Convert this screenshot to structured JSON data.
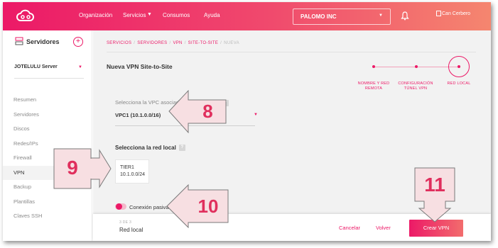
{
  "topbar": {
    "nav": [
      "Organización",
      "Servicios",
      "Consumos",
      "Ayuda"
    ],
    "company": "PALOMO INC",
    "user": "Can Cerbero",
    "logo_icon": "cloud-logo",
    "bell_icon": "bell-icon"
  },
  "sidebar": {
    "title": "Servidores",
    "add_icon": "plus-circle-icon",
    "server": "JOTELULU Server",
    "menu": [
      "Resumen",
      "Servidores",
      "Discos",
      "Redes/IPs",
      "Firewall",
      "VPN",
      "Backup",
      "Plantillas",
      "Claves SSH"
    ],
    "active_item": "VPN"
  },
  "main": {
    "breadcrumb": [
      "SERVICIOS",
      "SERVIDORES",
      "VPN",
      "SITE-TO-SITE",
      "NUEVA"
    ],
    "title": "Nueva VPN Site-to-Site",
    "steps": [
      {
        "line1": "NOMBRE Y RED",
        "line2": "REMOTA"
      },
      {
        "line1": "CONFIGURACIÓN",
        "line2": "TÚNEL VPN"
      },
      {
        "line1": "RED LOCAL",
        "line2": ""
      }
    ],
    "vpc_label": "Selecciona la VPC asociada a la Red Local*",
    "vpc_value": "VPC1 (10.1.0.0/16)",
    "network_label": "Selecciona la red local",
    "network": {
      "name": "TIER1",
      "cidr": "10.1.0.0/24"
    },
    "passive_label": "Conexión pasiva",
    "help_glyph": "?"
  },
  "footer": {
    "step": "3 DE 3",
    "name": "Red local",
    "cancel": "Cancelar",
    "back": "Volver",
    "create": "Crear VPN"
  },
  "callouts": [
    "8",
    "9",
    "10",
    "11"
  ],
  "colors": {
    "accent": "#ec1967",
    "callout_bg": "#f7dfe2",
    "callout_text": "#e02f5d"
  }
}
